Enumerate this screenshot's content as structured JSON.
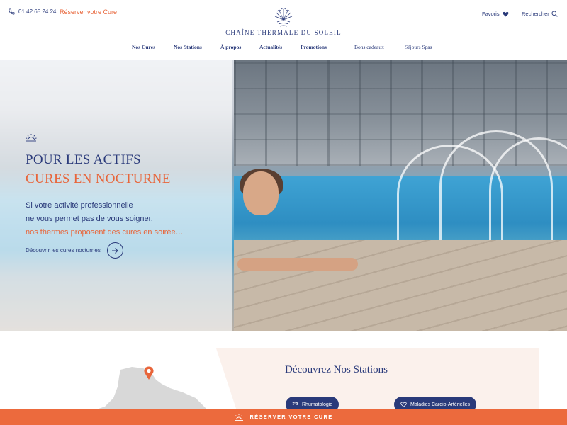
{
  "header": {
    "phone": "01 42 65 24 24",
    "reserve_link": "Réserver votre Cure",
    "logo_text": "CHAÎNE THERMALE DU SOLEIL",
    "favoris": "Favoris",
    "search": "Rechercher"
  },
  "nav": {
    "items": [
      {
        "label": "Nos Cures"
      },
      {
        "label": "Nos Stations"
      },
      {
        "label": "À propos"
      },
      {
        "label": "Actualités"
      },
      {
        "label": "Promotions"
      },
      {
        "label": "Bons cadeaux"
      },
      {
        "label": "Séjours Spas"
      }
    ]
  },
  "hero": {
    "title_line1": "POUR LES ACTIFS",
    "title_line2": "CURES EN NOCTURNE",
    "desc_line1": "Si votre activité professionnelle",
    "desc_line2": "ne vous permet pas de vous soigner,",
    "desc_line3": "nos thermes proposent des cures en soirée…",
    "cta_label": "Découvrir les cures nocturnes"
  },
  "stations": {
    "title": "Découvrez Nos Stations",
    "chips": [
      {
        "label": "Rhumatologie",
        "icon": "bone-icon"
      },
      {
        "label": "Maladies Cardio-Artérielles",
        "icon": "heart-icon"
      }
    ]
  },
  "bottom_bar": {
    "label": "RÉSERVER VOTRE CURE"
  },
  "colors": {
    "primary": "#2a3a7a",
    "accent": "#e8653a",
    "section_bg": "#fbf1ec"
  }
}
